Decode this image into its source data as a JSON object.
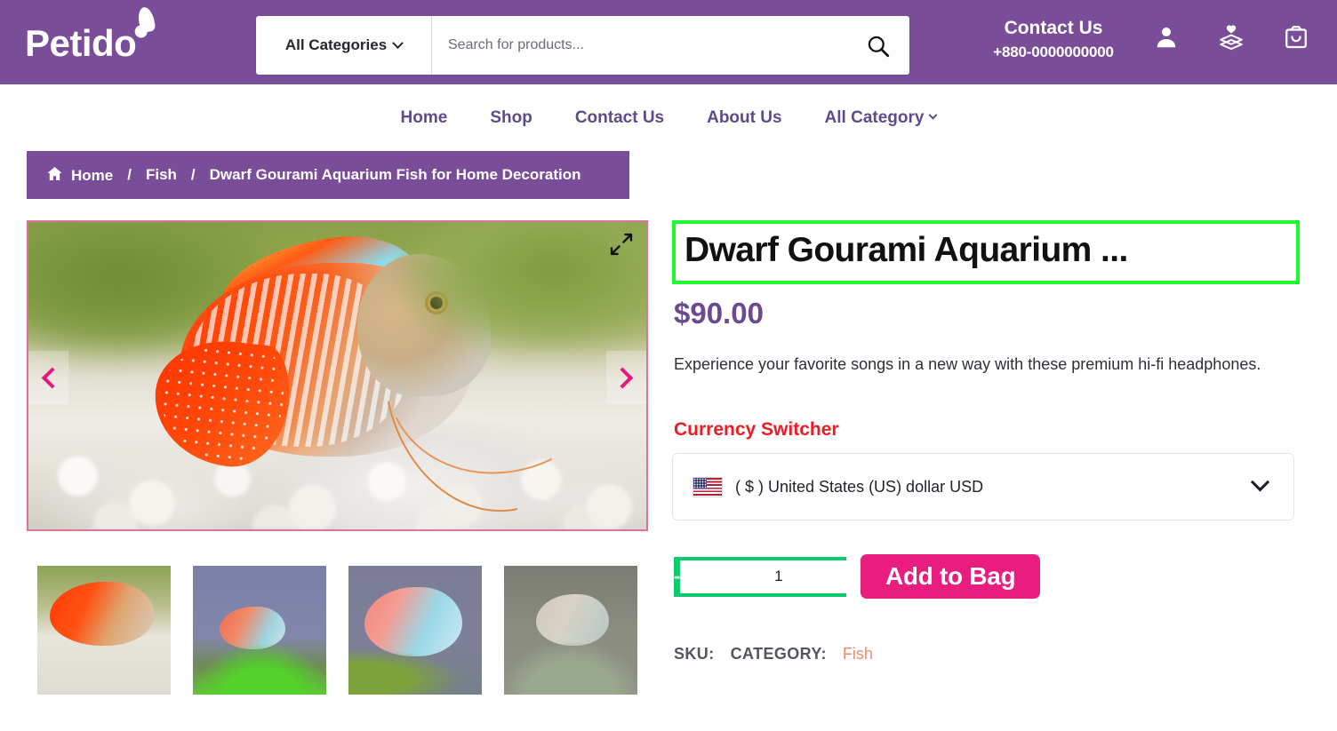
{
  "header": {
    "logo_text": "Petido",
    "search": {
      "category_label": "All Categories",
      "placeholder": "Search for products...",
      "value": "",
      "search_icon": "search-icon"
    },
    "contact": {
      "title": "Contact Us",
      "phone": "+880-0000000000"
    },
    "icons": [
      {
        "name": "account-icon",
        "label": "Account"
      },
      {
        "name": "wishlist-box-icon",
        "label": "Wishlist"
      },
      {
        "name": "shopping-bag-icon",
        "label": "Cart"
      }
    ]
  },
  "nav": {
    "items": [
      {
        "label": "Home",
        "has_chevron": false
      },
      {
        "label": "Shop",
        "has_chevron": false
      },
      {
        "label": "Contact Us",
        "has_chevron": false
      },
      {
        "label": "About Us",
        "has_chevron": false
      },
      {
        "label": "All Category",
        "has_chevron": true
      }
    ]
  },
  "breadcrumb": {
    "home_icon": "home-icon",
    "items": [
      {
        "label": "Home"
      },
      {
        "label": "Fish"
      },
      {
        "label": "Dwarf Gourami Aquarium Fish for Home Decoration"
      }
    ],
    "separator": "/"
  },
  "gallery": {
    "prev_label": "Previous image",
    "next_label": "Next image",
    "expand_label": "Expand image",
    "thumbnails": [
      {
        "alt": "Dwarf gourami on white gravel"
      },
      {
        "alt": "Dwarf gourami near green plants"
      },
      {
        "alt": "Dwarf gourami on grey background"
      },
      {
        "alt": "Dwarf gourami among plants"
      }
    ]
  },
  "product": {
    "title": "Dwarf Gourami Aquarium ...",
    "price": "$90.00",
    "description": "Experience your favorite songs in a new way with these premium hi-fi headphones.",
    "currency_switcher": {
      "heading": "Currency Switcher",
      "selected": "( $ ) United States (US) dollar USD",
      "flag": "us-flag-icon",
      "chevron": "chevron-down-icon"
    },
    "quantity": {
      "decrement_label": "-",
      "increment_label": "+",
      "value": "1"
    },
    "add_to_cart_label": "Add to Bag",
    "meta": {
      "sku_label": "SKU:",
      "sku_value": "",
      "category_label": "CATEGORY:",
      "category_value": "Fish"
    }
  },
  "colors": {
    "brand_purple": "#7a4d99",
    "nav_purple": "#5d4b8c",
    "price_purple": "#6b4a8f",
    "accent_pink": "#e81d7f",
    "qty_green": "#0ccb6e",
    "currency_red": "#ef1b22",
    "category_salmon": "#f08a6a",
    "highlight_green": "#1dfa2f"
  }
}
